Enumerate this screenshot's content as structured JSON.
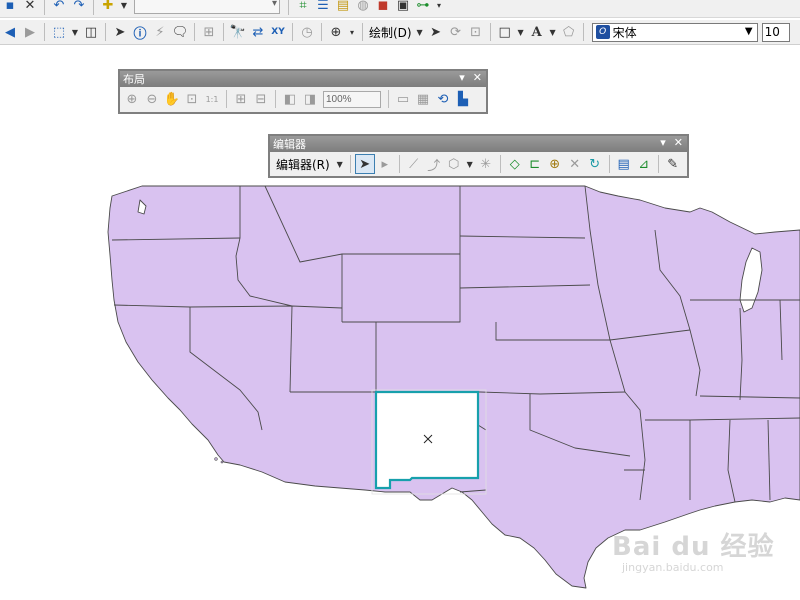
{
  "toolbar_top": {
    "icons": [
      "save-icon",
      "delete-icon",
      "undo-icon",
      "redo-icon",
      "add-data-icon",
      "scale-dropdown",
      "editor-toolbar-icon",
      "table-of-contents-icon",
      "catalog-icon",
      "search-window-icon",
      "arctoolbox-icon",
      "python-icon",
      "model-builder-icon"
    ]
  },
  "toolbar_tools": {
    "draw_menu_label": "绘制(D)",
    "font_name": "宋体",
    "font_size": "10",
    "icons": [
      "back-icon",
      "forward-icon",
      "select-features-icon",
      "clear-selection-icon",
      "select-elements-icon",
      "identify-icon",
      "html-popup-icon",
      "hyperlink-icon",
      "measure-icon",
      "find-icon",
      "go-to-xy-icon",
      "time-slider-icon",
      "viewer-window-icon"
    ]
  },
  "layout_toolbar": {
    "title": "布局",
    "zoom_value": "100%"
  },
  "editor_toolbar": {
    "title": "编辑器",
    "menu_label": "编辑器(R)"
  },
  "map": {
    "fill_color": "#d9c2f0",
    "border_color": "#4a4a4a",
    "selected_state_fill": "#ffffff",
    "selection_outline_color": "#17a0ac"
  },
  "watermark": {
    "brand": "Bai du 经验",
    "url": "jingyan.baidu.com"
  }
}
